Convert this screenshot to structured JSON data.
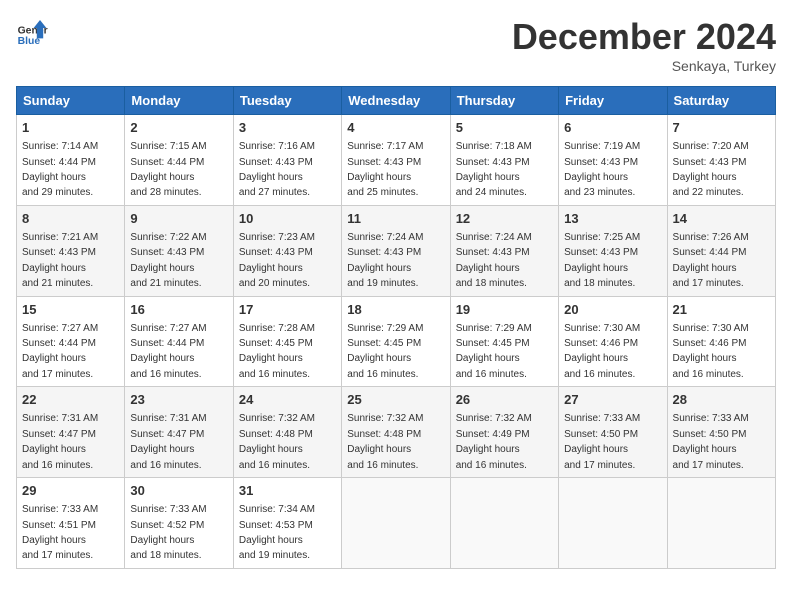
{
  "header": {
    "logo_line1": "General",
    "logo_line2": "Blue",
    "month": "December 2024",
    "location": "Senkaya, Turkey"
  },
  "days_of_week": [
    "Sunday",
    "Monday",
    "Tuesday",
    "Wednesday",
    "Thursday",
    "Friday",
    "Saturday"
  ],
  "weeks": [
    [
      {
        "day": 1,
        "sunrise": "7:14 AM",
        "sunset": "4:44 PM",
        "daylight": "9 hours and 29 minutes."
      },
      {
        "day": 2,
        "sunrise": "7:15 AM",
        "sunset": "4:44 PM",
        "daylight": "9 hours and 28 minutes."
      },
      {
        "day": 3,
        "sunrise": "7:16 AM",
        "sunset": "4:43 PM",
        "daylight": "9 hours and 27 minutes."
      },
      {
        "day": 4,
        "sunrise": "7:17 AM",
        "sunset": "4:43 PM",
        "daylight": "9 hours and 25 minutes."
      },
      {
        "day": 5,
        "sunrise": "7:18 AM",
        "sunset": "4:43 PM",
        "daylight": "9 hours and 24 minutes."
      },
      {
        "day": 6,
        "sunrise": "7:19 AM",
        "sunset": "4:43 PM",
        "daylight": "9 hours and 23 minutes."
      },
      {
        "day": 7,
        "sunrise": "7:20 AM",
        "sunset": "4:43 PM",
        "daylight": "9 hours and 22 minutes."
      }
    ],
    [
      {
        "day": 8,
        "sunrise": "7:21 AM",
        "sunset": "4:43 PM",
        "daylight": "9 hours and 21 minutes."
      },
      {
        "day": 9,
        "sunrise": "7:22 AM",
        "sunset": "4:43 PM",
        "daylight": "9 hours and 21 minutes."
      },
      {
        "day": 10,
        "sunrise": "7:23 AM",
        "sunset": "4:43 PM",
        "daylight": "9 hours and 20 minutes."
      },
      {
        "day": 11,
        "sunrise": "7:24 AM",
        "sunset": "4:43 PM",
        "daylight": "9 hours and 19 minutes."
      },
      {
        "day": 12,
        "sunrise": "7:24 AM",
        "sunset": "4:43 PM",
        "daylight": "9 hours and 18 minutes."
      },
      {
        "day": 13,
        "sunrise": "7:25 AM",
        "sunset": "4:43 PM",
        "daylight": "9 hours and 18 minutes."
      },
      {
        "day": 14,
        "sunrise": "7:26 AM",
        "sunset": "4:44 PM",
        "daylight": "9 hours and 17 minutes."
      }
    ],
    [
      {
        "day": 15,
        "sunrise": "7:27 AM",
        "sunset": "4:44 PM",
        "daylight": "9 hours and 17 minutes."
      },
      {
        "day": 16,
        "sunrise": "7:27 AM",
        "sunset": "4:44 PM",
        "daylight": "9 hours and 16 minutes."
      },
      {
        "day": 17,
        "sunrise": "7:28 AM",
        "sunset": "4:45 PM",
        "daylight": "9 hours and 16 minutes."
      },
      {
        "day": 18,
        "sunrise": "7:29 AM",
        "sunset": "4:45 PM",
        "daylight": "9 hours and 16 minutes."
      },
      {
        "day": 19,
        "sunrise": "7:29 AM",
        "sunset": "4:45 PM",
        "daylight": "9 hours and 16 minutes."
      },
      {
        "day": 20,
        "sunrise": "7:30 AM",
        "sunset": "4:46 PM",
        "daylight": "9 hours and 16 minutes."
      },
      {
        "day": 21,
        "sunrise": "7:30 AM",
        "sunset": "4:46 PM",
        "daylight": "9 hours and 16 minutes."
      }
    ],
    [
      {
        "day": 22,
        "sunrise": "7:31 AM",
        "sunset": "4:47 PM",
        "daylight": "9 hours and 16 minutes."
      },
      {
        "day": 23,
        "sunrise": "7:31 AM",
        "sunset": "4:47 PM",
        "daylight": "9 hours and 16 minutes."
      },
      {
        "day": 24,
        "sunrise": "7:32 AM",
        "sunset": "4:48 PM",
        "daylight": "9 hours and 16 minutes."
      },
      {
        "day": 25,
        "sunrise": "7:32 AM",
        "sunset": "4:48 PM",
        "daylight": "9 hours and 16 minutes."
      },
      {
        "day": 26,
        "sunrise": "7:32 AM",
        "sunset": "4:49 PM",
        "daylight": "9 hours and 16 minutes."
      },
      {
        "day": 27,
        "sunrise": "7:33 AM",
        "sunset": "4:50 PM",
        "daylight": "9 hours and 17 minutes."
      },
      {
        "day": 28,
        "sunrise": "7:33 AM",
        "sunset": "4:50 PM",
        "daylight": "9 hours and 17 minutes."
      }
    ],
    [
      {
        "day": 29,
        "sunrise": "7:33 AM",
        "sunset": "4:51 PM",
        "daylight": "9 hours and 17 minutes."
      },
      {
        "day": 30,
        "sunrise": "7:33 AM",
        "sunset": "4:52 PM",
        "daylight": "9 hours and 18 minutes."
      },
      {
        "day": 31,
        "sunrise": "7:34 AM",
        "sunset": "4:53 PM",
        "daylight": "9 hours and 19 minutes."
      },
      null,
      null,
      null,
      null
    ]
  ]
}
